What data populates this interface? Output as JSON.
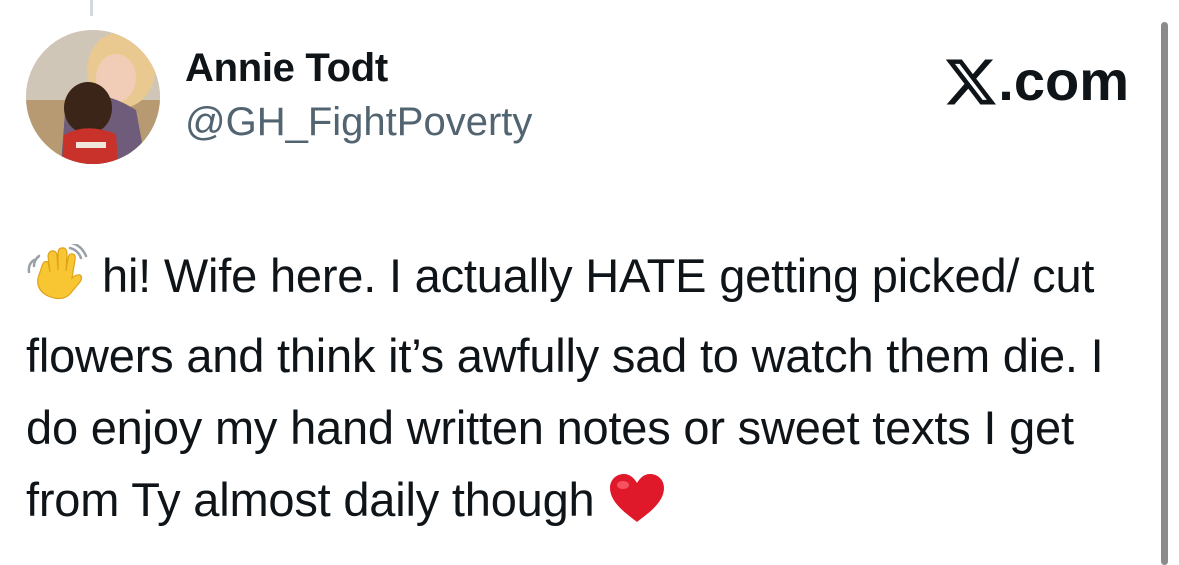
{
  "author": {
    "display_name": "Annie Todt",
    "handle": "@GH_FightPoverty"
  },
  "brand": {
    "name": ".com",
    "logo_icon": "x-logo-icon"
  },
  "tweet": {
    "leading_emoji": "waving-hand-icon",
    "text": "hi! Wife here. I actually HATE getting picked/ cut flowers and think it’s awfully sad to watch them die. I do enjoy my hand written notes or sweet texts I get from Ty almost daily though",
    "trailing_emoji": "red-heart-icon"
  },
  "colors": {
    "text_primary": "#0f1419",
    "text_secondary": "#536471",
    "heart": "#e0192a",
    "wave_hand": "#f7c632"
  }
}
